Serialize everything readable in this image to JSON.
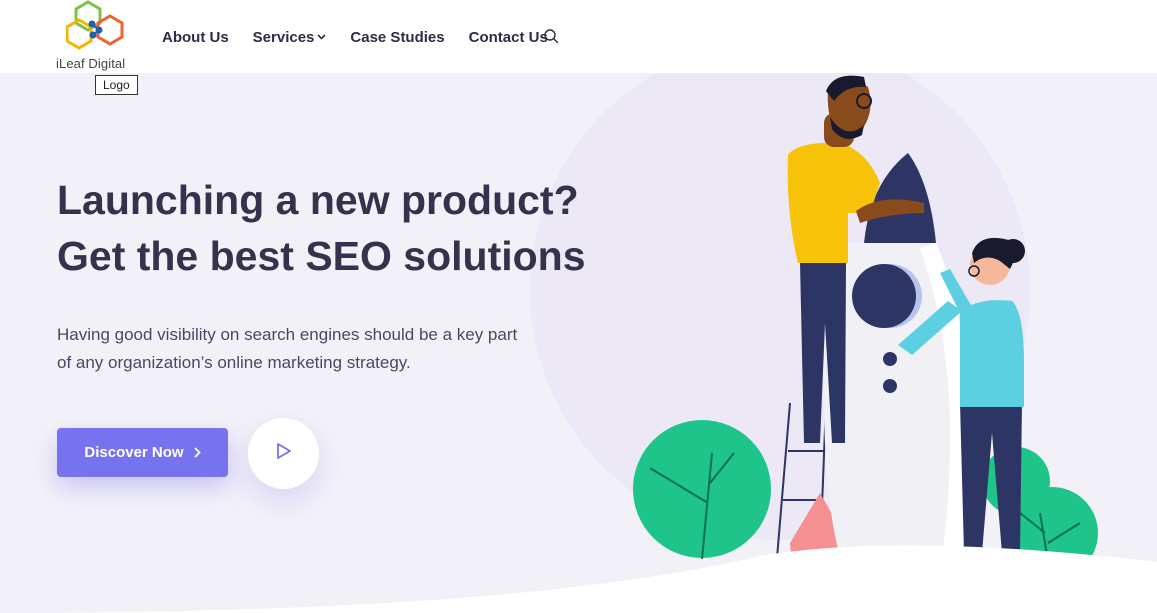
{
  "brand": {
    "name": "iLeaf Digital",
    "tooltip": "Logo"
  },
  "nav": {
    "items": [
      {
        "label": "About Us"
      },
      {
        "label": "Services",
        "has_dropdown": true
      },
      {
        "label": "Case Studies"
      },
      {
        "label": "Contact Us"
      }
    ],
    "search_icon": "search-icon"
  },
  "hero": {
    "title_line1": "Launching a new product?",
    "title_line2": "Get the best SEO solutions",
    "subtitle": "Having good visibility on search engines should be a key part of any organization’s online marketing strategy.",
    "cta_label": "Discover Now",
    "cta_icon": "chevron-right-icon",
    "play_icon": "play-icon"
  },
  "colors": {
    "accent": "#7772ee",
    "background": "#f3f1f8",
    "heading": "#36324d",
    "tree_green": "#1fc48a",
    "shirt_yellow": "#f6c20a",
    "shirt_blue": "#5ccfe0",
    "navy": "#2d3565"
  }
}
